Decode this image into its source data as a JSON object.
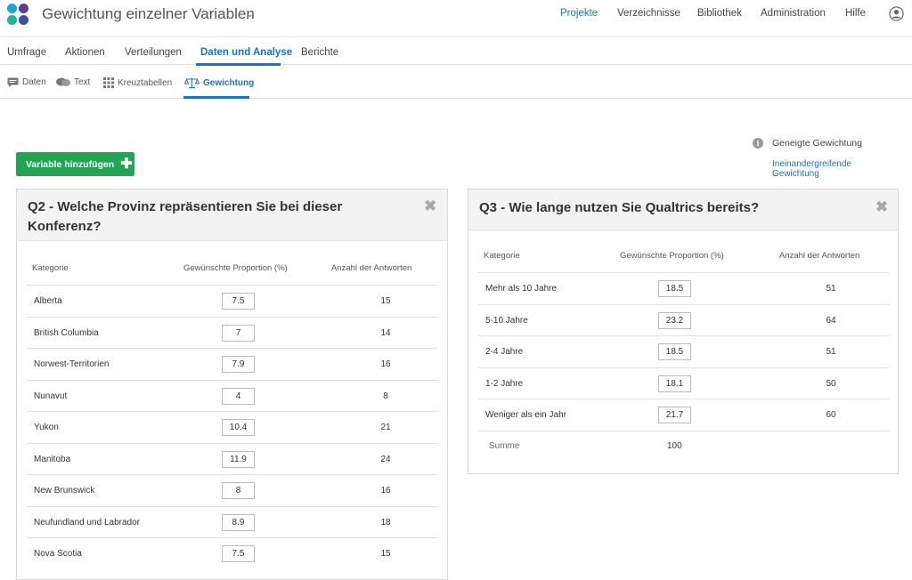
{
  "header": {
    "project_title": "Gewichtung einzelner Variablen",
    "nav": [
      "Projekte",
      "Verzeichnisse",
      "Bibliothek",
      "Administration",
      "Hilfe"
    ],
    "nav_active": "Projekte",
    "logo_colors": [
      "#1fa7d8",
      "#5a3e8e",
      "#1fb5a0",
      "#3f4f9a"
    ]
  },
  "tabs": {
    "items": [
      "Umfrage",
      "Aktionen",
      "Verteilungen",
      "Daten und Analyse",
      "Berichte"
    ],
    "active": "Daten und Analyse"
  },
  "subtabs": {
    "items": [
      {
        "label": "Daten",
        "icon": "chat-bubble-icon"
      },
      {
        "label": "Text",
        "icon": "chat-bubbles-icon"
      },
      {
        "label": "Kreuztabellen",
        "icon": "grid-icon"
      },
      {
        "label": "Gewichtung",
        "icon": "balance-scale-icon"
      }
    ],
    "active": "Gewichtung"
  },
  "toolbar": {
    "add_variable_label": "Variable hinzufügen"
  },
  "options": {
    "inclined_weighting": "Geneigte Gewichtung",
    "interlocking_link": "Ineinandergreifende Gewichtung"
  },
  "q2": {
    "title": "Q2 - Welche Provinz repräsentieren Sie bei dieser Konferenz?",
    "columns": [
      "Kategorie",
      "Gewünschte Proportion (%)",
      "Anzahl der Antworten"
    ],
    "rows": [
      {
        "category": "Alberta",
        "proportion": "7.5",
        "count": "15"
      },
      {
        "category": "British Columbia",
        "proportion": "7",
        "count": "14"
      },
      {
        "category": "Norwest-Territorien",
        "proportion": "7.9",
        "count": "16"
      },
      {
        "category": "Nunavut",
        "proportion": "4",
        "count": "8"
      },
      {
        "category": "Yukon",
        "proportion": "10.4",
        "count": "21"
      },
      {
        "category": "Manitoba",
        "proportion": "11.9",
        "count": "24"
      },
      {
        "category": "New Brunswick",
        "proportion": "8",
        "count": "16"
      },
      {
        "category": "Neufundland und Labrador",
        "proportion": "8.9",
        "count": "18"
      },
      {
        "category": "Nova Scotia",
        "proportion": "7.5",
        "count": "15"
      }
    ]
  },
  "q3": {
    "title": "Q3 - Wie lange nutzen Sie Qualtrics bereits?",
    "columns": [
      "Kategorie",
      "Gewünschte Proportion (%)",
      "Anzahl der Antworten"
    ],
    "rows": [
      {
        "category": "Mehr als 10 Jahre",
        "proportion": "18.5",
        "count": "51"
      },
      {
        "category": "5-10 Jahre",
        "proportion": "23.2",
        "count": "64"
      },
      {
        "category": "2-4 Jahre",
        "proportion": "18.5",
        "count": "51"
      },
      {
        "category": "1-2 Jahre",
        "proportion": "18.1",
        "count": "50"
      },
      {
        "category": "Weniger als ein Jahr",
        "proportion": "21.7",
        "count": "60"
      }
    ],
    "sum_label": "Summe",
    "sum_value": "100"
  }
}
